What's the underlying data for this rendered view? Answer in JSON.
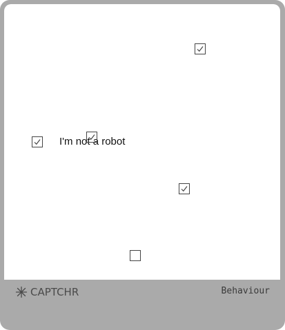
{
  "captcha": {
    "prompt_label": "I'm not a robot",
    "checkboxes": [
      {
        "id": "cb-1",
        "checked": true
      },
      {
        "id": "cb-2",
        "checked": true
      },
      {
        "id": "cb-3",
        "checked": true
      },
      {
        "id": "cb-4",
        "checked": true
      },
      {
        "id": "cb-5",
        "checked": false
      }
    ]
  },
  "footer": {
    "brand_name": "CAPTCHR",
    "brand_icon": "asterisk-icon",
    "mode_label": "Behaviour"
  },
  "colors": {
    "frame": "#aaaaaa",
    "panel": "#ffffff",
    "checkbox_border": "#444444"
  }
}
